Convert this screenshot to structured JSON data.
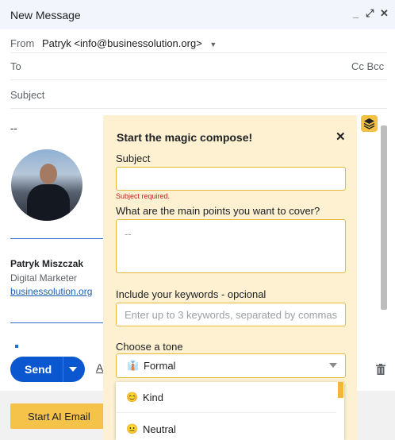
{
  "window": {
    "title": "New Message",
    "controls": {
      "minimize": "_",
      "popout": "⤢",
      "close": "✕"
    }
  },
  "compose": {
    "from_label": "From",
    "from_value": "Patryk <info@businessolution.org>",
    "to_label": "To",
    "cc_bcc": "Cc Bcc",
    "subject_placeholder": "Subject"
  },
  "signature": {
    "dash": "--",
    "name": "Patryk Miszczak",
    "role": "Digital Marketer",
    "link": "businessolution.org"
  },
  "toolbar": {
    "send_label": "Send",
    "format_glyph": "A"
  },
  "footer": {
    "ai_button": "Start AI Email"
  },
  "magic_compose": {
    "title": "Start the magic compose!",
    "close": "✕",
    "subject_label": "Subject",
    "subject_value": "",
    "subject_error": "Subject required.",
    "points_label": "What are the main points you want to cover?",
    "points_value": "--",
    "keywords_label": "Include your keywords - opcional",
    "keywords_placeholder": "Enter up to 3 keywords, separated by commas",
    "tone_label": "Choose a tone",
    "tone_selected": {
      "emoji": "👔",
      "label": "Formal"
    },
    "tone_options": [
      {
        "emoji": "😊",
        "label": "Kind"
      },
      {
        "emoji": "😐",
        "label": "Neutral"
      }
    ]
  },
  "colors": {
    "panel_bg": "#fdf1d2",
    "accent": "#f5c24a",
    "send_blue": "#0b57d0",
    "error": "#c5221f"
  }
}
